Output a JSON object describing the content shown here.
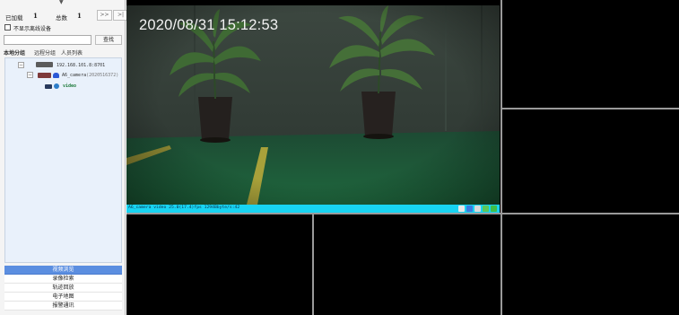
{
  "sidebar": {
    "loaded_label": "已加载",
    "loaded_value": "1",
    "total_label": "总数",
    "total_value": "1",
    "next_page": ">>",
    "last_page": ">|",
    "hide_offline_label": "不显示离线设备",
    "search_placeholder": "",
    "search_button": "查找",
    "tabs": [
      "本地分组",
      "远程分组",
      "人员列表"
    ],
    "tree": {
      "nvr_ip": "192.168.101.8:8701",
      "camera_name": "A6_camera",
      "camera_serial": "(2020516372)",
      "channel_name": "video"
    },
    "nav_items": [
      "视频浏览",
      "录像检索",
      "轨迹回放",
      "电子地图",
      "报警通讯"
    ]
  },
  "video": {
    "timestamp": "2020/08/31 15:12:53",
    "status_text": "A6_camera video 25.0(17.4)fps 1294Bbyte/s:42"
  },
  "colors": {
    "status_bar": "#18d4f2",
    "nav_active": "#5b8ee0",
    "tree_bg": "#e9f1fb"
  },
  "icons": [
    "collapse-arrow-icon",
    "nvr-icon",
    "camera-icon",
    "globe-icon",
    "record-icon",
    "snapshot-icon",
    "audio-icon",
    "close-icon"
  ]
}
